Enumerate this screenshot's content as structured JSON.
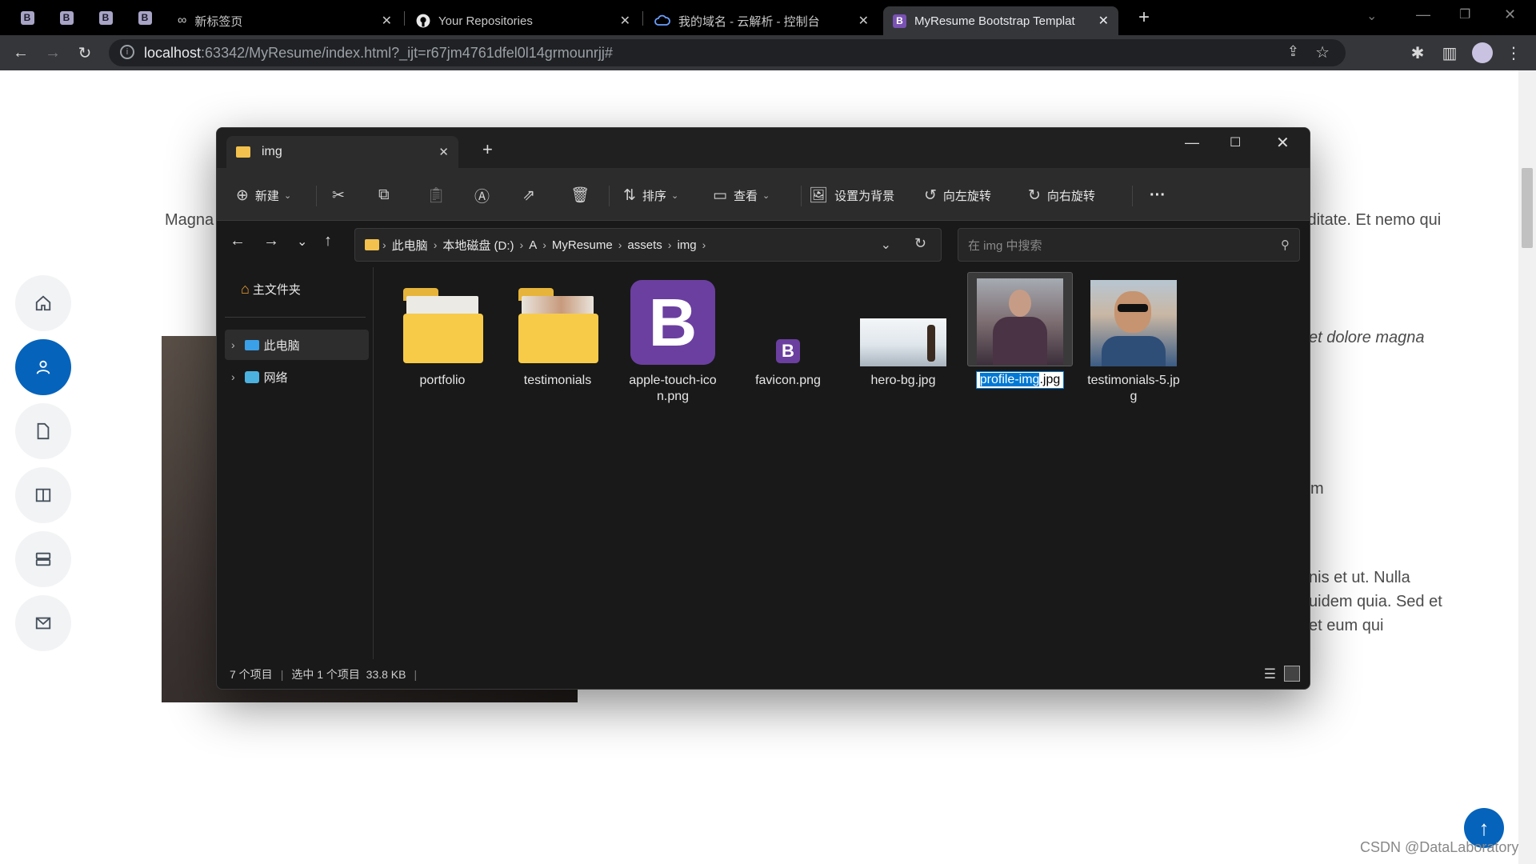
{
  "browser": {
    "pinned_tab_glyph": "B",
    "tabs": [
      {
        "label": "新标签页",
        "icon": "infinity-icon"
      },
      {
        "label": "Your Repositories",
        "icon": "github-icon"
      },
      {
        "label": "我的域名 - 云解析 - 控制台",
        "icon": "cloud-icon"
      },
      {
        "label": "MyResume Bootstrap Templat",
        "icon": "bootstrap-icon",
        "active": true
      }
    ],
    "new_tab": "+",
    "url_host": "localhost",
    "url_rest": ":63342/MyResume/index.html?_ijt=r67jm4761dfel0l14grmounrjj#"
  },
  "page": {
    "text_left": "Magna",
    "text_right_1": "iditate. Et nemo qui",
    "text_right_2": "et dolore magna",
    "text_right_3": "m",
    "text_right_4": "nis et ut. Nulla",
    "text_right_5": "uidem quia. Sed et",
    "text_right_6": "et eum qui",
    "nav": [
      "home-icon",
      "person-icon",
      "file-icon",
      "book-icon",
      "server-icon",
      "envelope-icon"
    ],
    "active_nav": 1,
    "watermark": "CSDN @DataLaboratory",
    "accent": "#0563bb"
  },
  "explorer": {
    "tab_title": "img",
    "new_tab": "+",
    "commands": {
      "new": "新建",
      "sort": "排序",
      "view": "查看",
      "set_bg": "设置为背景",
      "rotate_left": "向左旋转",
      "rotate_right": "向右旋转",
      "more": "···"
    },
    "breadcrumb": [
      "此电脑",
      "本地磁盘 (D:)",
      "A",
      "MyResume",
      "assets",
      "img"
    ],
    "search_placeholder": "在 img 中搜索",
    "nav_home": "主文件夹",
    "nav_items": [
      "此电脑",
      "网络"
    ],
    "files": [
      {
        "name": "portfolio",
        "kind": "folder"
      },
      {
        "name": "testimonials",
        "kind": "folder"
      },
      {
        "name": "apple-touch-icon.png",
        "kind": "bootstrap-large"
      },
      {
        "name": "favicon.png",
        "kind": "bootstrap-small"
      },
      {
        "name": "hero-bg.jpg",
        "kind": "image"
      },
      {
        "name": "profile-img.jpg",
        "kind": "image",
        "selected": true,
        "rename_highlight": "profile-img",
        "rename_rest": ".jpg"
      },
      {
        "name": "testimonials-5.jpg",
        "kind": "image"
      }
    ],
    "status": {
      "count": "7 个项目",
      "selection": "选中 1 个项目  33.8 KB"
    }
  }
}
